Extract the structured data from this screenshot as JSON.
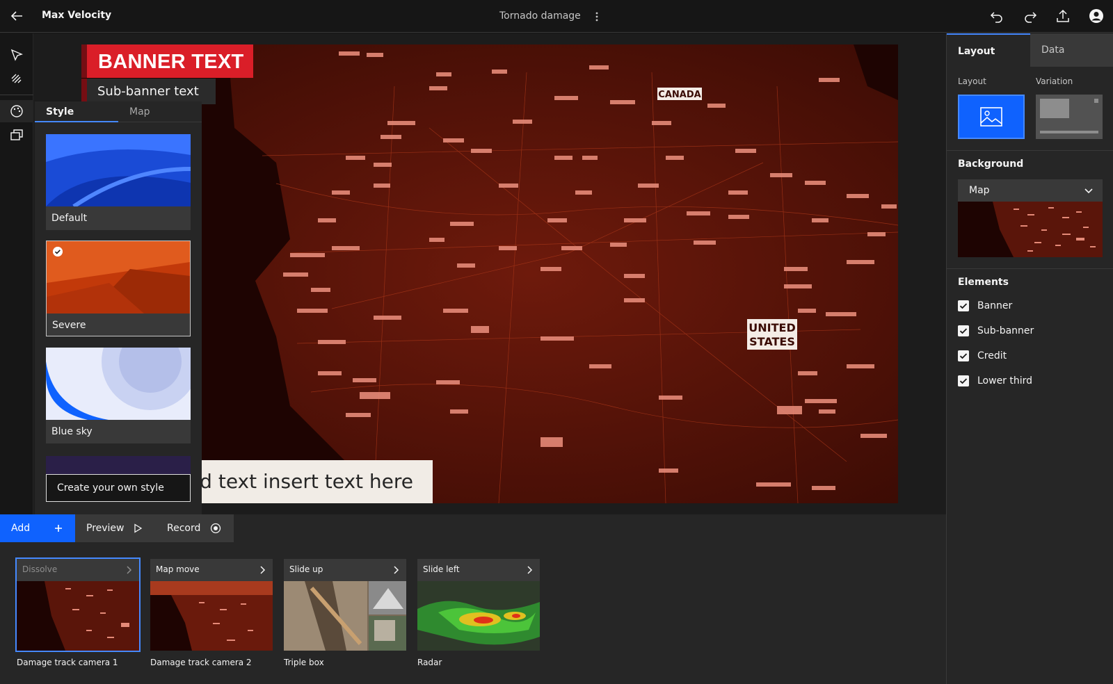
{
  "topbar": {
    "app_title": "Max Velocity",
    "doc_title": "Tornado damage"
  },
  "canvas": {
    "banner_text": "BANNER TEXT",
    "subbanner_text": "Sub-banner text",
    "lower_third_text": "d text insert text here",
    "map_labels": {
      "canada": "CANADA",
      "united": "UNITED",
      "states": "STATES"
    }
  },
  "style_panel": {
    "tabs": [
      "Style",
      "Map"
    ],
    "cards": [
      {
        "label": "Default"
      },
      {
        "label": "Severe"
      },
      {
        "label": "Blue sky"
      }
    ],
    "create_label": "Create your own style"
  },
  "right_panel": {
    "tabs": [
      "Layout",
      "Data"
    ],
    "layout_label": "Layout",
    "variation_label": "Variation",
    "background_heading": "Background",
    "background_value": "Map",
    "elements_heading": "Elements",
    "elements": [
      {
        "label": "Banner",
        "checked": true
      },
      {
        "label": "Sub-banner",
        "checked": true
      },
      {
        "label": "Credit",
        "checked": true
      },
      {
        "label": "Lower third",
        "checked": true
      }
    ]
  },
  "bottom": {
    "add_label": "Add",
    "preview_label": "Preview",
    "record_label": "Record",
    "clips": [
      {
        "transition": "Dissolve",
        "caption": "Damage track camera 1"
      },
      {
        "transition": "Map move",
        "caption": "Damage track camera 2"
      },
      {
        "transition": "Slide up",
        "caption": "Triple box"
      },
      {
        "transition": "Slide left",
        "caption": "Radar"
      }
    ]
  },
  "colors": {
    "accent": "#0f62fe",
    "banner_red": "#da1e28",
    "map_base": "#3a0b04"
  }
}
